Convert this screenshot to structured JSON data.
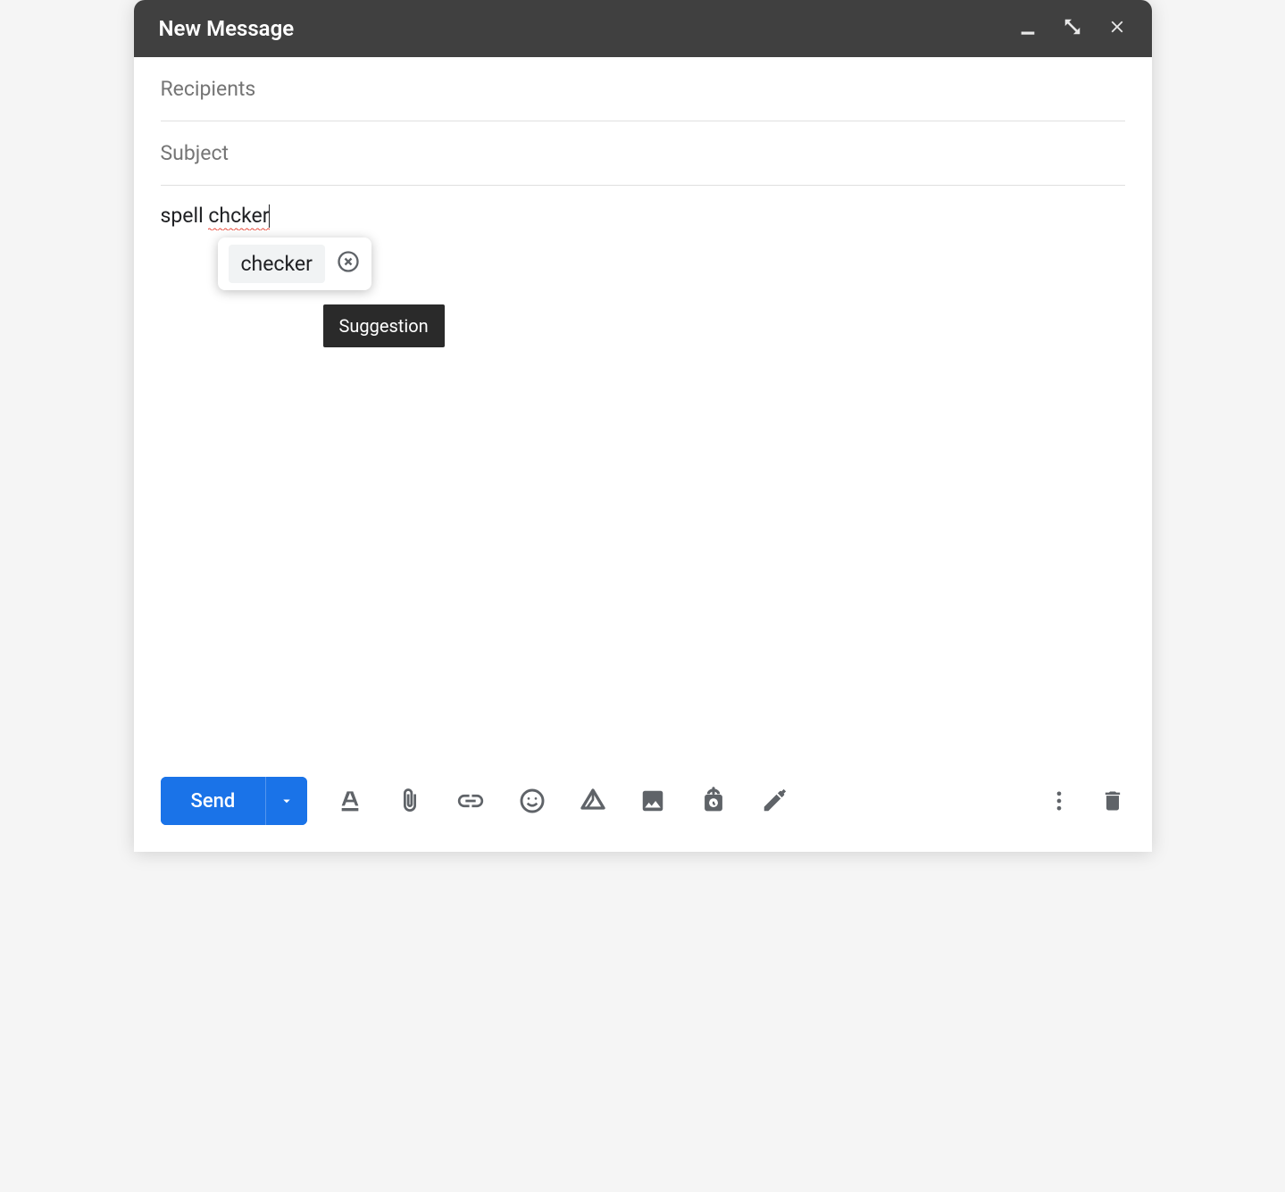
{
  "header": {
    "title": "New Message"
  },
  "fields": {
    "recipients_placeholder": "Recipients",
    "recipients_value": "",
    "subject_placeholder": "Subject",
    "subject_value": ""
  },
  "body": {
    "text_before": "spell ",
    "misspelled_word": "chcker"
  },
  "suggestion": {
    "word": "checker",
    "tooltip": "Suggestion"
  },
  "footer": {
    "send_label": "Send"
  },
  "icons": {
    "minimize": "minimize",
    "expand": "expand",
    "close": "close",
    "dismiss": "dismiss",
    "send_more": "arrow-drop-down",
    "text_format": "text-format",
    "attach": "attach",
    "link": "link",
    "emoji": "emoji",
    "drive": "drive",
    "image": "image",
    "confidential": "confidential",
    "pen": "pen",
    "more": "more-vert",
    "delete": "delete"
  }
}
